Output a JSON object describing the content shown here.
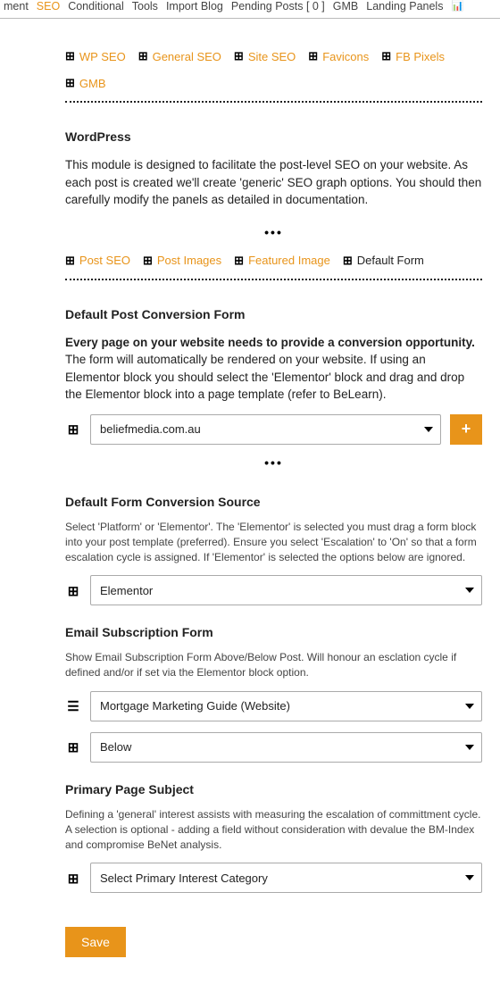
{
  "top_nav": {
    "items": [
      "ment",
      "SEO",
      "Conditional",
      "Tools",
      "Import Blog",
      "Pending Posts  [ 0 ]",
      "GMB",
      "Landing Panels"
    ]
  },
  "sub_nav1": {
    "items": [
      "WP SEO",
      "General SEO",
      "Site SEO",
      "Favicons",
      "FB Pixels",
      "GMB"
    ]
  },
  "wordpress": {
    "title": "WordPress",
    "desc": "This module is designed to facilitate the post-level SEO on your website. As each post is created we'll create 'generic' SEO graph options. You should then carefully modify the panels as detailed in documentation."
  },
  "sub_nav2": {
    "items": [
      "Post SEO",
      "Post Images",
      "Featured Image",
      "Default Form"
    ]
  },
  "conversion_form": {
    "title": "Default Post Conversion Form",
    "lead": "Every page on your website needs to provide a conversion opportunity.",
    "rest": " The form will automatically be rendered on your website. If using an Elementor block you should select the 'Elementor' block and drag and drop the Elementor block into a page template (refer to BeLearn).",
    "value": "beliefmedia.com.au"
  },
  "conversion_source": {
    "title": "Default Form Conversion Source",
    "desc": "Select 'Platform' or 'Elementor'. The 'Elementor' is selected you must drag a form block into your post template (preferred). Ensure you select 'Escalation' to 'On' so that a form escalation cycle is assigned. If 'Elementor' is selected the options below are ignored.",
    "value": "Elementor"
  },
  "email_sub": {
    "title": "Email Subscription Form",
    "desc": "Show Email Subscription Form Above/Below Post. Will honour an esclation cycle if defined and/or if set via the Elementor block option.",
    "value1": "Mortgage Marketing Guide (Website)",
    "value2": "Below"
  },
  "primary_subject": {
    "title": "Primary Page Subject",
    "desc": "Defining a 'general' interest assists with measuring the escalation of committment cycle. A selection is optional - adding a field without consideration with devalue the BM-Index and compromise BeNet analysis.",
    "value": "Select Primary Interest Category"
  },
  "save_label": "Save",
  "add_label": "+"
}
